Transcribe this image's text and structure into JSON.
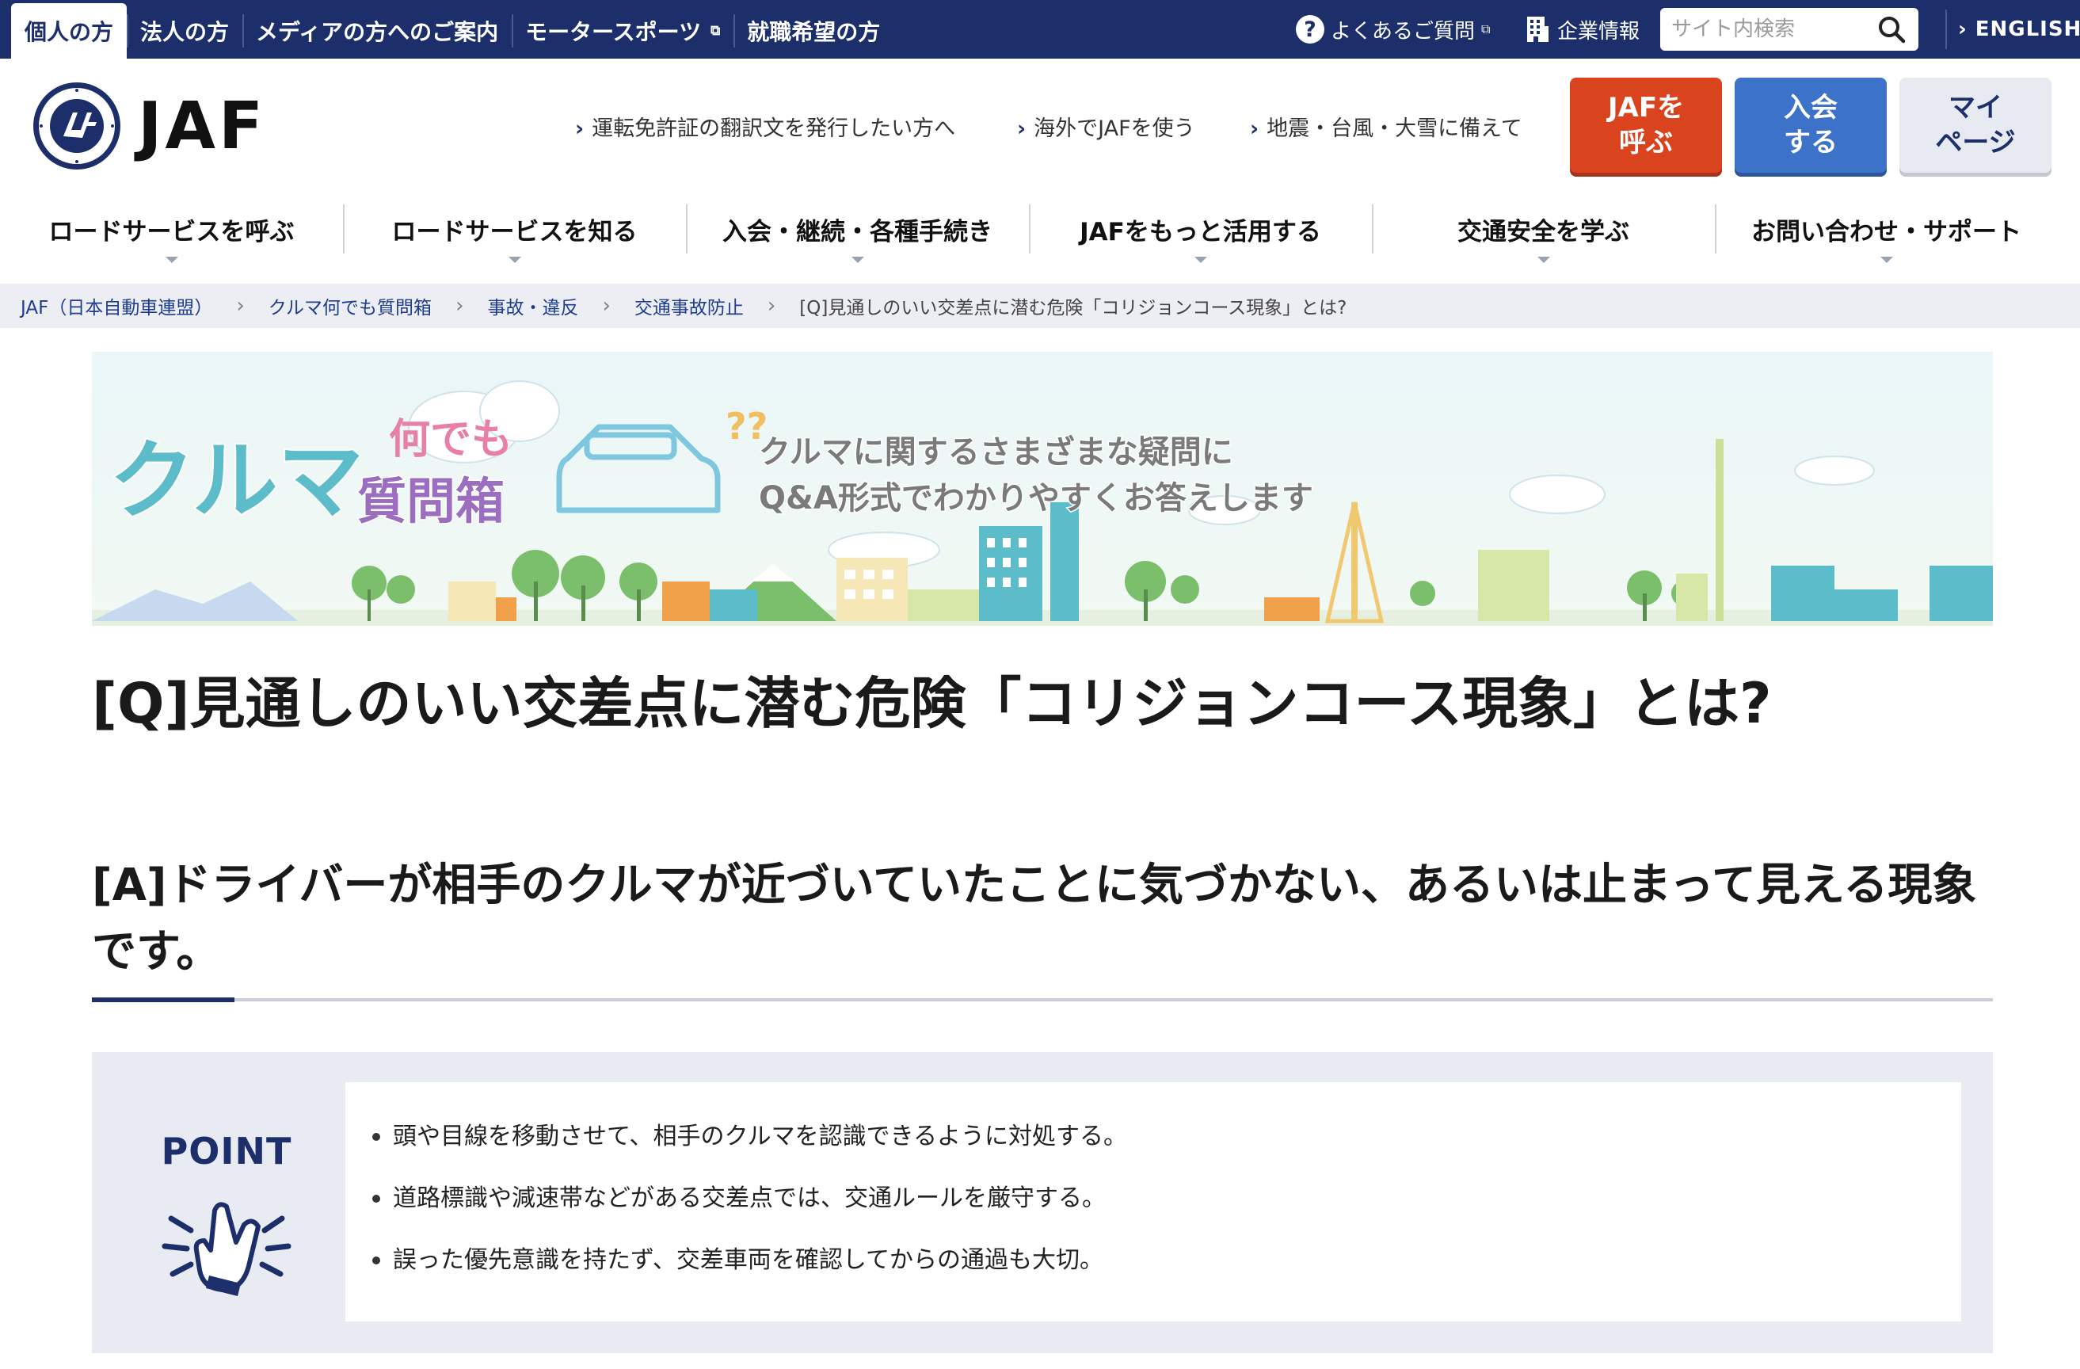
{
  "topbar": {
    "tabs": [
      {
        "label": "個人の方",
        "active": true
      },
      {
        "label": "法人の方",
        "active": false
      },
      {
        "label": "メディアの方へのご案内",
        "active": false
      },
      {
        "label": "モータースポーツ",
        "active": false,
        "external": true
      },
      {
        "label": "就職希望の方",
        "active": false
      }
    ],
    "faq_label": "よくあるご質問",
    "corp_label": "企業情報",
    "search_placeholder": "サイト内検索",
    "english_label": "ENGLISH"
  },
  "header": {
    "logo_text": "JAF",
    "quick_links": [
      "運転免許証の翻訳文を発行したい方へ",
      "海外でJAFを使う",
      "地震・台風・大雪に備えて"
    ],
    "buttons": {
      "call": "JAFを\n呼ぶ",
      "join": "入会\nする",
      "mypage": "マイ\nページ"
    }
  },
  "gnav": [
    "ロードサービスを呼ぶ",
    "ロードサービスを知る",
    "入会・継続・各種手続き",
    "JAFをもっと活用する",
    "交通安全を学ぶ",
    "お問い合わせ・サポート"
  ],
  "breadcrumb": {
    "links": [
      "JAF（日本自動車連盟）",
      "クルマ何でも質問箱",
      "事故・違反",
      "交通事故防止"
    ],
    "current": "[Q]見通しのいい交差点に潜む危険「コリジョンコース現象」とは?"
  },
  "banner": {
    "title_main": "クルマ",
    "title_sub1": "何でも",
    "title_sub2": "質問箱",
    "tagline1": "クルマに関するさまざまな疑問に",
    "tagline2": "Q&A形式でわかりやすくお答えします"
  },
  "article": {
    "question": "[Q]見通しのいい交差点に潜む危険「コリジョンコース現象」とは?",
    "answer": "[A]ドライバーが相手のクルマが近づいていたことに気づかない、あるいは止まって見える現象です。"
  },
  "point": {
    "label": "POINT",
    "items": [
      "頭や目線を移動させて、相手のクルマを認識できるように対処する。",
      "道路標識や減速帯などがある交差点では、交通ルールを厳守する。",
      "誤った優先意識を持たず、交差車両を確認してからの通過も大切。"
    ]
  },
  "colors": {
    "navy": "#1d2f6b",
    "call_button": "#d9441f",
    "join_button": "#3d72c9",
    "mypage_button": "#e7eaf0"
  }
}
